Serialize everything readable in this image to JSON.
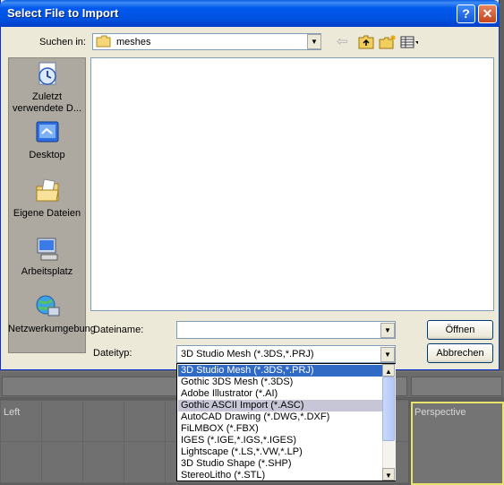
{
  "window": {
    "title": "Select File to Import",
    "help_glyph": "?",
    "close_glyph": "✕"
  },
  "lookin": {
    "label": "Suchen in:",
    "value": "meshes"
  },
  "places": [
    {
      "label": "Zuletzt verwendete D...",
      "icon": "recent-documents-icon"
    },
    {
      "label": "Desktop",
      "icon": "desktop-icon"
    },
    {
      "label": "Eigene Dateien",
      "icon": "my-documents-icon"
    },
    {
      "label": "Arbeitsplatz",
      "icon": "my-computer-icon"
    },
    {
      "label": "Netzwerkumgebung",
      "icon": "network-places-icon"
    }
  ],
  "filename": {
    "label": "Dateiname:",
    "value": ""
  },
  "filetype": {
    "label": "Dateityp:",
    "value": "3D Studio Mesh (*.3DS,*.PRJ)",
    "options": [
      "3D Studio Mesh (*.3DS,*.PRJ)",
      "Gothic 3DS Mesh (*.3DS)",
      "Adobe Illustrator (*.AI)",
      "Gothic ASCII Import (*.ASC)",
      "AutoCAD Drawing (*.DWG,*.DXF)",
      "FiLMBOX (*.FBX)",
      "IGES (*.IGE,*.IGS,*.IGES)",
      "Lightscape (*.LS,*.VW,*.LP)",
      "3D Studio Shape (*.SHP)",
      "StereoLitho (*.STL)"
    ]
  },
  "buttons": {
    "open": "Öffnen",
    "cancel": "Abbrechen"
  },
  "viewports": {
    "left": "Left",
    "perspective": "Perspective"
  },
  "colors": {
    "titlebar": "#0054e3",
    "selection": "#316ac5",
    "viewport_active": "#e8e36a"
  }
}
